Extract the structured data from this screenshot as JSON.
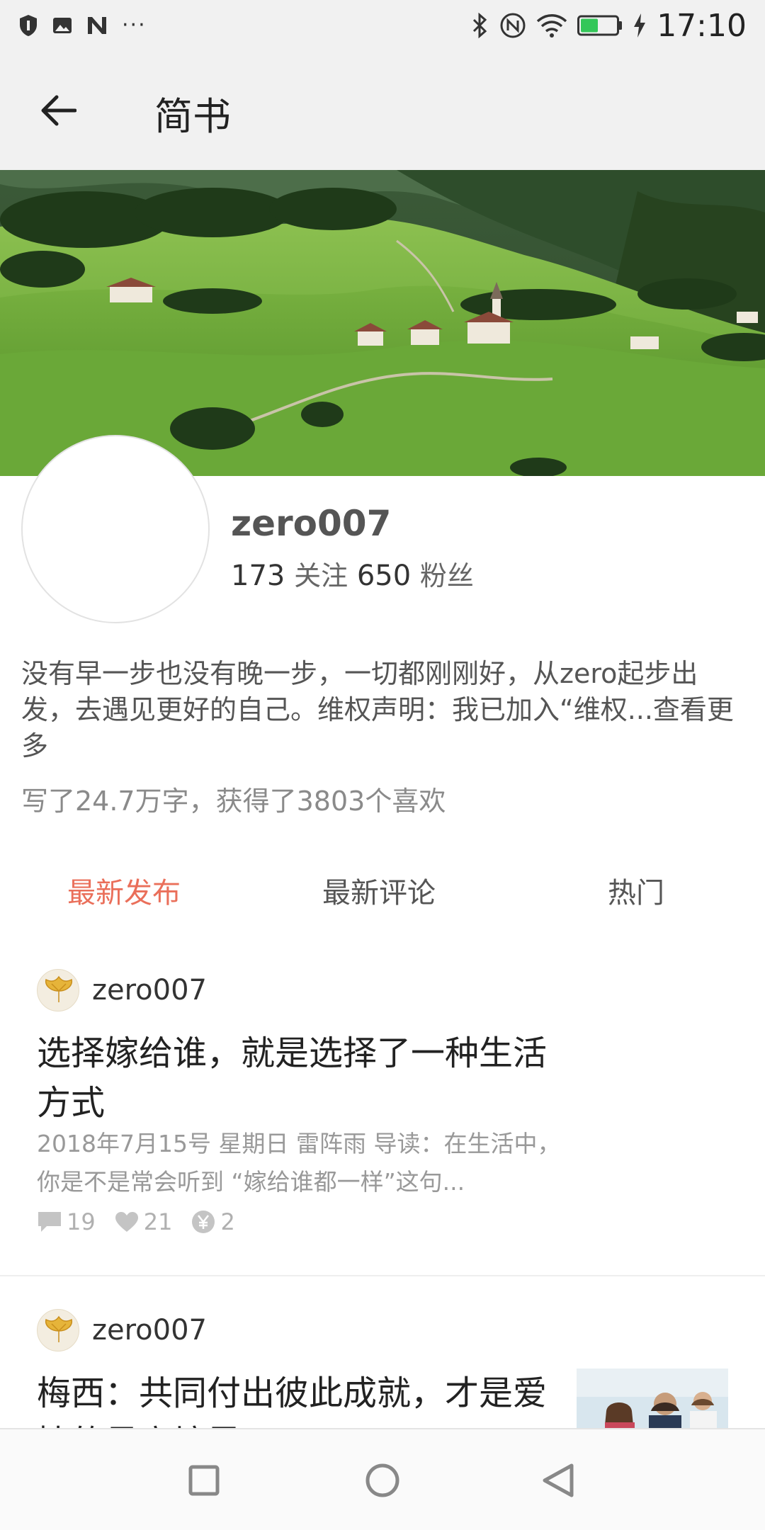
{
  "status_bar": {
    "time": "17:10",
    "left_icons": [
      "shield-icon",
      "image-icon",
      "n-icon",
      "more-dots-icon"
    ],
    "right_icons": [
      "bluetooth-icon",
      "nfc-icon",
      "wifi-icon",
      "battery-icon",
      "charging-icon"
    ],
    "more_dots": "···"
  },
  "app_bar": {
    "title": "简书"
  },
  "profile": {
    "username": "zero007",
    "following_count": "173",
    "following_label": "关注",
    "followers_count": "650",
    "followers_label": "粉丝",
    "bio": "没有早一步也没有晚一步，一切都刚刚好，从zero起步出发，去遇见更好的自己。维权声明：我已加入“维权...查看更多",
    "summary": "写了24.7万字，获得了3803个喜欢"
  },
  "tabs": [
    {
      "label": "最新发布",
      "active": true
    },
    {
      "label": "最新评论",
      "active": false
    },
    {
      "label": "热门",
      "active": false
    }
  ],
  "articles": [
    {
      "author": "zero007",
      "title": "选择嫁给谁，就是选择了一种生活方式",
      "abstract": "2018年7月15号 星期日 雷阵雨 导读：在生活中，你是不是常会听到 “嫁给谁都一样”这句...",
      "comments": "19",
      "likes": "21",
      "rewards": "2"
    },
    {
      "author": "zero007",
      "title": "梅西：共同付出彼此成就，才是爱情的最高境界"
    }
  ],
  "colors": {
    "accent": "#ea6f5a",
    "header_bg": "#f1f1f1"
  }
}
